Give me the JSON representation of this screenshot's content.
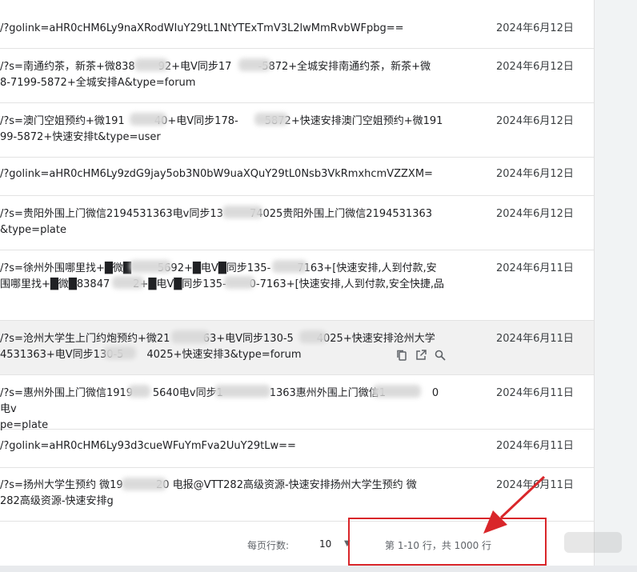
{
  "rows": [
    {
      "line1": "/?golink=aHR0cHM6Ly9naXRodWIuY29tL1NtYTExTmV3L2lwMmRvbWFpbg==",
      "line2": "",
      "date": "2024年6月12日"
    },
    {
      "line1": "/?s=南通约茶，新茶+微838       92+电V同步17        -5872+全城安排南通约茶，新茶+微",
      "line2": "8-7199-5872+全城安排A&type=forum",
      "date": "2024年6月12日"
    },
    {
      "line1": "/?s=澳门空姐预约+微191         40+电V同步178-        5872+快速安排澳门空姐预约+微191",
      "line2": "99-5872+快速安排t&type=user",
      "date": "2024年6月12日"
    },
    {
      "line1": "/?golink=aHR0cHM6Ly9zdG9jay5ob3N0bW9uaXQuY29tL0Nsb3VkRmxhcmVZZXM=",
      "line2": "",
      "date": "2024年6月12日"
    },
    {
      "line1": "/?s=贵阳外围上门微信2194531363电v同步13        74025贵阳外围上门微信2194531363",
      "line2": "&type=plate",
      "date": "2024年6月12日"
    },
    {
      "line1": "/?s=徐州外围哪里找+█微█        5692+█电V█同步135-        7163+[快速安排,人到付款,安",
      "line2": "围哪里找+█微█83847       2+█电V█同步135-       0-7163+[快速安排,人到付款,安全快捷,品",
      "date": "2024年6月11日"
    },
    {
      "line1": "/?s=沧州大学生上门约炮预约+微21          63+电V同步130-5       4025+快速安排沧州大学",
      "line2": "4531363+电V同步130-5       4025+快速安排3&type=forum",
      "date": "2024年6月11日"
    },
    {
      "line1": "/?s=惠州外围上门微信1919      5640电v同步1              1363惠州外围上门微信1              0电v",
      "line2": "pe=plate",
      "date": "2024年6月11日"
    },
    {
      "line1": "/?golink=aHR0cHM6Ly93d3cueWFuYmFva2UuY29tLw==",
      "line2": "",
      "date": "2024年6月11日"
    },
    {
      "line1": "/?s=扬州大学生预约 微19          20 电报@VTT282高级资源-快速安排扬州大学生预约 微",
      "line2": "282高级资源-快速安排g",
      "date": "2024年6月11日"
    }
  ],
  "footer": {
    "rows_per_page_label": "每页行数:",
    "rows_per_page_value": "10",
    "range_text": "第 1-10 行，共 1000 行"
  },
  "colors": {
    "annotation": "#d9262a",
    "hover_row": "#f1f1f1"
  },
  "icons": [
    "copy-icon",
    "open-in-new-icon",
    "search-icon",
    "dropdown-caret-icon"
  ]
}
